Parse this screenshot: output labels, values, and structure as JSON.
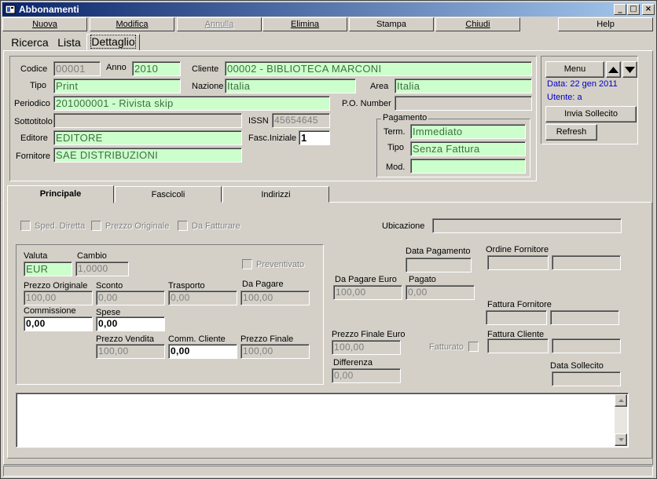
{
  "window": {
    "title": "Abbonamenti",
    "min": "_",
    "max": "□",
    "close": "×"
  },
  "toolbar": {
    "nuova": "Nuova",
    "modifica": "Modifica",
    "annulla": "Annulla",
    "elimina": "Elimina",
    "stampa": "Stampa",
    "chiudi": "Chiudi",
    "help": "Help"
  },
  "tabs": {
    "ricerca": "Ricerca",
    "lista": "Lista",
    "dettaglio": "Dettaglio"
  },
  "header": {
    "codice_label": "Codice",
    "codice": "00001",
    "anno_label": "Anno",
    "anno": "2010",
    "cliente_label": "Cliente",
    "cliente": "00002 - BIBLIOTECA MARCONI",
    "tipo_label": "Tipo",
    "tipo": "Print",
    "nazione_label": "Nazione",
    "nazione": "Italia",
    "area_label": "Area",
    "area": "Italia",
    "periodico_label": "Periodico",
    "periodico": "201000001 - Rivista skip",
    "po_label": "P.O. Number",
    "po": "",
    "sottotitolo_label": "Sottotitolo",
    "sottotitolo": "",
    "issn_label": "ISSN",
    "issn": "45654645",
    "editore_label": "Editore",
    "editore": "EDITORE",
    "fasc_label": "Fasc.Iniziale",
    "fasc": "1",
    "fornitore_label": "Fornitore",
    "fornitore": "SAE DISTRIBUZIONI",
    "pagamento_title": "Pagamento",
    "term_label": "Term.",
    "term": "Immediato",
    "ptipo_label": "Tipo",
    "ptipo": "Senza Fattura",
    "mod_label": "Mod.",
    "mod": ""
  },
  "side": {
    "menu": "Menu",
    "data": "Data: 22 gen 2011",
    "utente": "Utente: a",
    "invia": "Invia Sollecito",
    "refresh": "Refresh"
  },
  "inner_tabs": {
    "principale": "Principale",
    "fascicoli": "Fascicoli",
    "indirizzi": "Indirizzi"
  },
  "principale": {
    "sped": "Sped. Diretta",
    "prezzo_orig_chk": "Prezzo Originale",
    "da_fatturare": "Da Fatturare",
    "ubicazione_label": "Ubicazione",
    "ubicazione": "",
    "valuta_label": "Valuta",
    "valuta": "EUR",
    "cambio_label": "Cambio",
    "cambio": "1,0000",
    "preventivato": "Preventivato",
    "prezzo_orig_label": "Prezzo Originale",
    "prezzo_orig": "100,00",
    "sconto_label": "Sconto",
    "sconto": "0,00",
    "trasporto_label": "Trasporto",
    "trasporto": "0,00",
    "da_pagare_label": "Da Pagare",
    "da_pagare": "100,00",
    "commissione_label": "Commissione",
    "commissione": "0,00",
    "spese_label": "Spese",
    "spese": "0,00",
    "prezzo_vendita_label": "Prezzo Vendita",
    "prezzo_vendita": "100,00",
    "comm_cliente_label": "Comm. Cliente",
    "comm_cliente": "0,00",
    "prezzo_finale_label": "Prezzo Finale",
    "prezzo_finale": "100,00",
    "data_pagamento_label": "Data Pagamento",
    "data_pagamento": "",
    "da_pagare_euro_label": "Da Pagare Euro",
    "da_pagare_euro": "100,00",
    "pagato_label": "Pagato",
    "pagato": "0,00",
    "prezzo_finale_euro_label": "Prezzo Finale Euro",
    "prezzo_finale_euro": "100,00",
    "fatturato": "Fatturato",
    "differenza_label": "Differenza",
    "differenza": "0,00",
    "ordine_fornitore_label": "Ordine Fornitore",
    "fattura_fornitore_label": "Fattura Fornitore",
    "fattura_cliente_label": "Fattura Cliente",
    "data_sollecito_label": "Data Sollecito"
  }
}
